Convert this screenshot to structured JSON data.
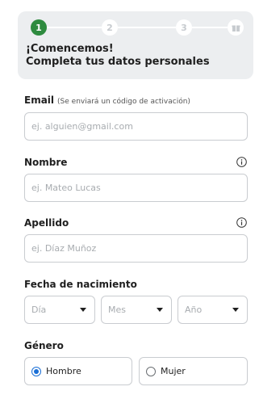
{
  "stepper": {
    "steps": [
      "1",
      "2",
      "3"
    ],
    "active_step": 1,
    "final_step_icon": "gift-icon"
  },
  "header": {
    "title": "¡Comencemos!",
    "subtitle": "Completa tus datos personales"
  },
  "email": {
    "label": "Email",
    "hint": "(Se enviará un código de activación)",
    "placeholder": "ej. alguien@gmail.com",
    "value": ""
  },
  "nombre": {
    "label": "Nombre",
    "placeholder": "ej. Mateo Lucas",
    "value": "",
    "info_icon": "info-icon"
  },
  "apellido": {
    "label": "Apellido",
    "placeholder": "ej. Díaz Muñoz",
    "value": "",
    "info_icon": "info-icon"
  },
  "birth": {
    "label": "Fecha de nacimiento",
    "day_placeholder": "Día",
    "month_placeholder": "Mes",
    "year_placeholder": "Año"
  },
  "gender": {
    "label": "Género",
    "options": [
      "Hombre",
      "Mujer"
    ],
    "selected": "Hombre"
  },
  "colors": {
    "accent": "#2e8b3f",
    "radio_selected": "#1a6fd6",
    "header_bg": "#eceef0"
  }
}
